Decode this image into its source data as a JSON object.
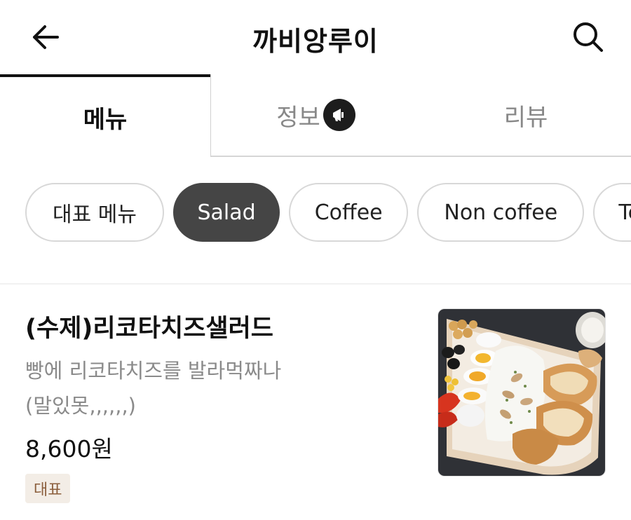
{
  "header": {
    "title": "까비앙루이",
    "back_icon": "arrow-left-icon",
    "search_icon": "search-icon"
  },
  "tabs": [
    {
      "label": "메뉴",
      "active": true
    },
    {
      "label": "정보",
      "active": false,
      "icon": "megaphone-icon"
    },
    {
      "label": "리뷰",
      "active": false
    }
  ],
  "categories": [
    {
      "label": "대표 메뉴",
      "selected": false
    },
    {
      "label": "Salad",
      "selected": true
    },
    {
      "label": "Coffee",
      "selected": false
    },
    {
      "label": "Non coffee",
      "selected": false
    },
    {
      "label": "Te",
      "selected": false
    }
  ],
  "menu_item": {
    "name": "(수제)리코타치즈샐러드",
    "description": "빵에 리코타치즈를 발라먹짜나\n(말있못,,,,,,)",
    "price": "8,600원",
    "badge": "대표"
  },
  "colors": {
    "selected_chip_bg": "#454545",
    "badge_bg": "#f3ede6",
    "badge_text": "#8b5e3c",
    "muted_text": "#888888"
  }
}
